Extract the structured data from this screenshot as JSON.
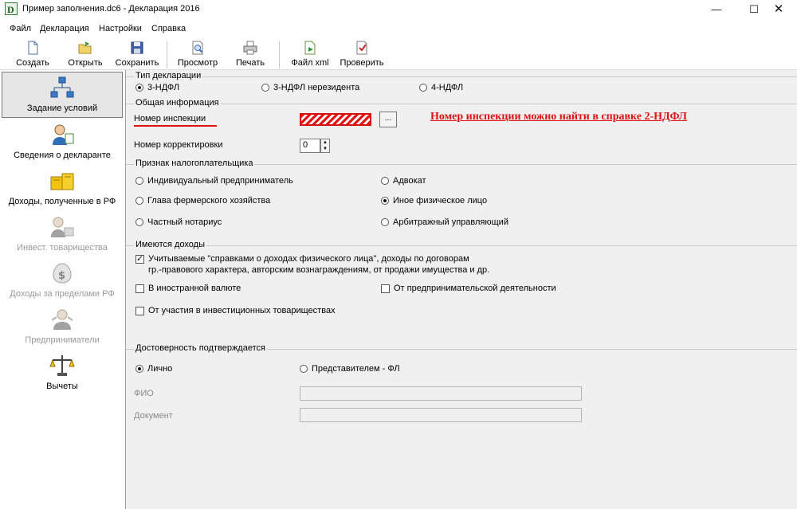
{
  "window": {
    "title": "Пример заполнения.dc6 - Декларация 2016",
    "controls": {
      "minimize": "—",
      "maximize": "☐",
      "close": "✕"
    }
  },
  "menu": [
    "Файл",
    "Декларация",
    "Настройки",
    "Справка"
  ],
  "toolbar": {
    "create": "Создать",
    "open": "Открыть",
    "save": "Сохранить",
    "preview": "Просмотр",
    "print": "Печать",
    "xml_file": "Файл xml",
    "check": "Проверить"
  },
  "sidebar": [
    {
      "label": "Задание условий",
      "icon": "conditions-icon",
      "active": true,
      "enabled": true
    },
    {
      "label": "Сведения о декларанте",
      "icon": "declarant-icon",
      "active": false,
      "enabled": true
    },
    {
      "label": "Доходы, полученные в РФ",
      "icon": "income-rf-icon",
      "active": false,
      "enabled": true
    },
    {
      "label": "Инвест. товарищества",
      "icon": "invest-partnership-icon",
      "active": false,
      "enabled": false
    },
    {
      "label": "Доходы за пределами РФ",
      "icon": "foreign-income-icon",
      "active": false,
      "enabled": false
    },
    {
      "label": "Предприниматели",
      "icon": "entrepreneurs-icon",
      "active": false,
      "enabled": false
    },
    {
      "label": "Вычеты",
      "icon": "deductions-icon",
      "active": false,
      "enabled": true
    }
  ],
  "declaration_type": {
    "legend": "Тип декларации",
    "options": [
      {
        "label": "3-НДФЛ",
        "selected": true
      },
      {
        "label": "3-НДФЛ нерезидента",
        "selected": false
      },
      {
        "label": "4-НДФЛ",
        "selected": false
      }
    ]
  },
  "general_info": {
    "legend": "Общая информация",
    "inspection_label": "Номер инспекции",
    "inspection_button": "...",
    "hint": "Номер инспекции можно найти в справке 2-НДФЛ",
    "correction_label": "Номер корректировки",
    "correction_value": "0"
  },
  "taxpayer": {
    "legend": "Признак налогоплательщика",
    "options": [
      {
        "label": "Индивидуальный предприниматель",
        "selected": false
      },
      {
        "label": "Адвокат",
        "selected": false
      },
      {
        "label": "Глава фермерского хозяйства",
        "selected": false
      },
      {
        "label": "Иное физическое лицо",
        "selected": true
      },
      {
        "label": "Частный нотариус",
        "selected": false
      },
      {
        "label": "Арбитражный управляющий",
        "selected": false
      }
    ]
  },
  "income": {
    "legend": "Имеются доходы",
    "options": [
      {
        "label_line1": "Учитываемые \"справками о доходах физического лица\", доходы по договорам",
        "label_line2": "гр.-правового характера, авторским вознаграждениям, от продажи имущества и др.",
        "checked": true
      },
      {
        "label": "В иностранной валюте",
        "checked": false
      },
      {
        "label": "От предпринимательской деятельности",
        "checked": false
      },
      {
        "label": "От участия в инвестиционных товариществах",
        "checked": false
      }
    ]
  },
  "reliability": {
    "legend": "Достоверность подтверждается",
    "options": [
      {
        "label": "Лично",
        "selected": true
      },
      {
        "label": "Представителем - ФЛ",
        "selected": false
      }
    ],
    "fio_label": "ФИО",
    "fio_value": "",
    "document_label": "Документ",
    "document_value": ""
  },
  "colors": {
    "accent_red": "#e01010",
    "panel_bg": "#f0f0f0",
    "sidebar_active": "#e6e6e6"
  }
}
